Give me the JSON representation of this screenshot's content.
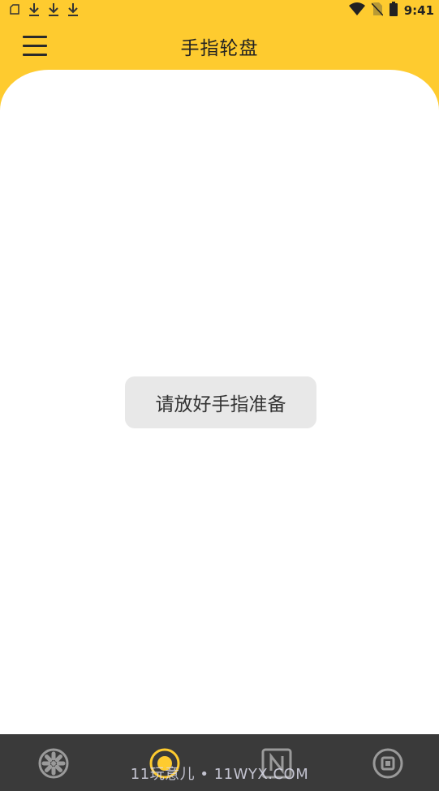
{
  "status_bar": {
    "time": "9:41",
    "left_icons": [
      "file-icon",
      "download-icon",
      "download-icon",
      "download-icon"
    ],
    "right_icons": [
      "wifi-icon",
      "no-sim-icon",
      "battery-icon"
    ]
  },
  "toolbar": {
    "title": "手指轮盘",
    "menu_icon": "menu-icon"
  },
  "main": {
    "toast_text": "请放好手指准备"
  },
  "bottom_nav": {
    "items": [
      {
        "icon": "wheel-icon",
        "active": false
      },
      {
        "icon": "target-icon",
        "active": true
      },
      {
        "icon": "n-box-icon",
        "active": false
      },
      {
        "icon": "stop-icon",
        "active": false
      }
    ]
  },
  "watermark": "11玩意儿 • 11WYX.COM",
  "colors": {
    "accent": "#FECB2F",
    "nav_background": "#3a3a3a",
    "toast_background": "#E8E8E8"
  }
}
